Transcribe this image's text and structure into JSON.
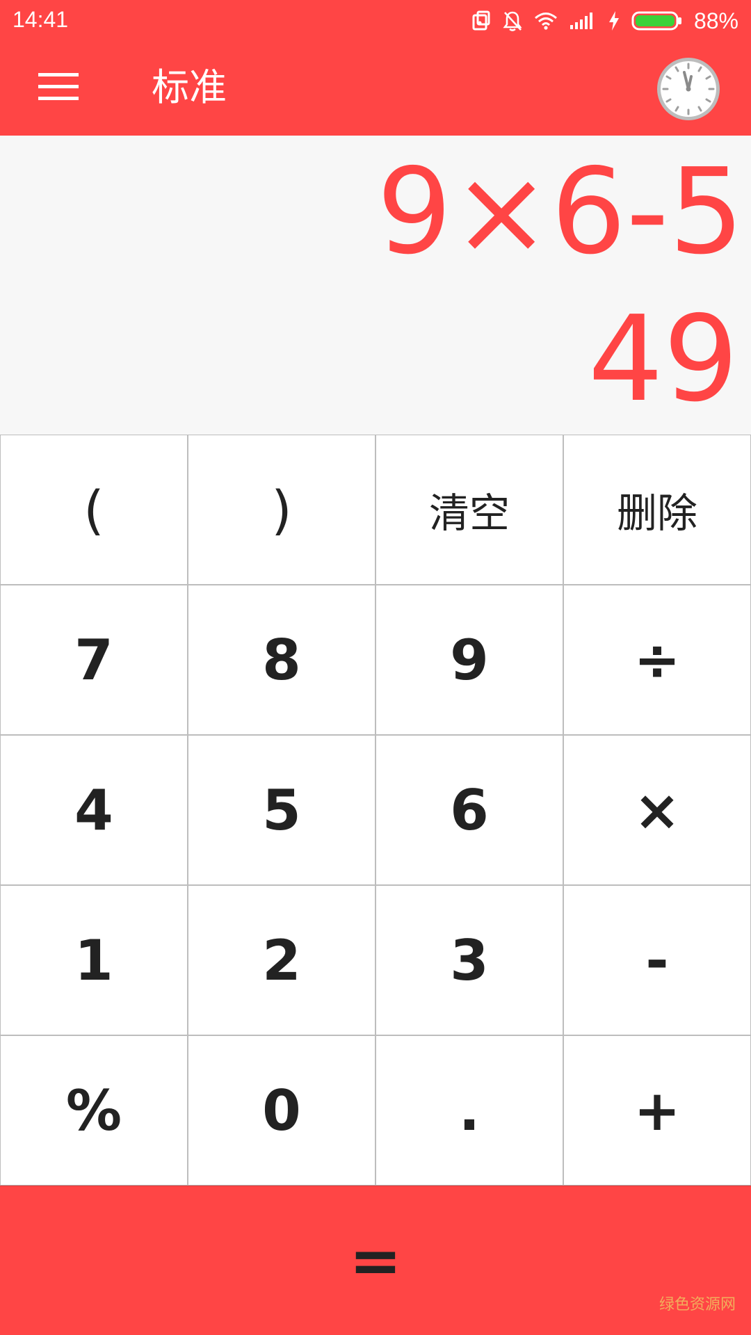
{
  "status_bar": {
    "time": "14:41",
    "battery_percent": "88%",
    "icons": [
      "screen-rotate-icon",
      "bell-muted-icon",
      "wifi-icon",
      "signal-icon",
      "charging-icon",
      "battery-icon"
    ]
  },
  "app_bar": {
    "title": "标准",
    "menu_icon": "hamburger-menu-icon",
    "history_icon": "clock-icon"
  },
  "display": {
    "expression": "9×6-5",
    "result": "49"
  },
  "keypad": {
    "rows": [
      [
        "(",
        ")",
        "清空",
        "删除"
      ],
      [
        "7",
        "8",
        "9",
        "÷"
      ],
      [
        "4",
        "5",
        "6",
        "×"
      ],
      [
        "1",
        "2",
        "3",
        "-"
      ],
      [
        "%",
        "0",
        ".",
        "+"
      ]
    ]
  },
  "equals_label": "=",
  "watermark": "绿色资源网",
  "colors": {
    "accent": "#ff4545",
    "display_bg": "#f7f7f7",
    "key_text": "#222222",
    "key_border": "#bdbdbd"
  }
}
